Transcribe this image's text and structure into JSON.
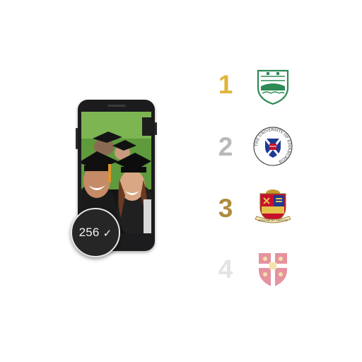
{
  "counter": {
    "value": "256",
    "icon": "check-icon"
  },
  "rankings": [
    {
      "rank": "1",
      "color": "#e0b43a",
      "crest": "stirling-crest-icon"
    },
    {
      "rank": "2",
      "color": "#b9b9b9",
      "crest": "edinburgh-crest-icon"
    },
    {
      "rank": "3",
      "color": "#b08b3f",
      "crest": "cambridge-college-crest-icon"
    },
    {
      "rank": "4",
      "color": "#e3e3e3",
      "crest": "cambridge-crest-icon"
    }
  ],
  "crest_texts": {
    "edinburgh_ring": "THE UNIVERSITY OF EDINBURGH",
    "college_motto": "HONORE ET VIRTUTE"
  }
}
